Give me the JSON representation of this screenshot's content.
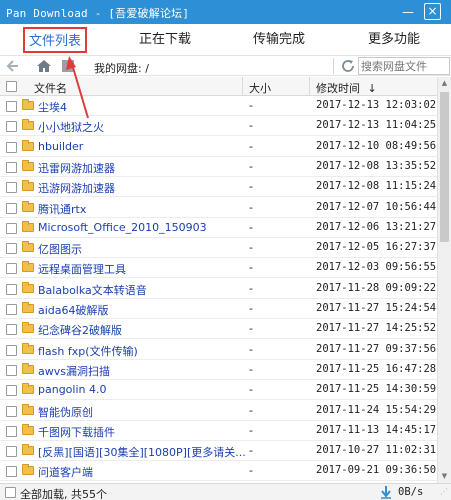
{
  "window": {
    "title": "Pan Download - [吾爱破解论坛]",
    "minimize_glyph": "—",
    "close_glyph": "×"
  },
  "tabs": [
    {
      "label": "文件列表",
      "active": true
    },
    {
      "label": "正在下载",
      "active": false
    },
    {
      "label": "传输完成",
      "active": false
    },
    {
      "label": "更多功能",
      "active": false
    }
  ],
  "toolbar": {
    "path": "我的网盘: /",
    "search_placeholder": "搜索网盘文件",
    "icons": [
      "back-arrow-icon",
      "home-icon",
      "stop-icon",
      "refresh-icon"
    ]
  },
  "table": {
    "columns": {
      "name": "文件名",
      "size": "大小",
      "time": "修改时间"
    },
    "sort_indicator": "↓",
    "rows": [
      {
        "name": "尘埃4",
        "size": "-",
        "time": "2017-12-13 12:03:02"
      },
      {
        "name": "小小地狱之火",
        "size": "-",
        "time": "2017-12-13 11:04:25"
      },
      {
        "name": "hbuilder",
        "size": "-",
        "time": "2017-12-10 08:49:56"
      },
      {
        "name": "迅雷网游加速器",
        "size": "-",
        "time": "2017-12-08 13:35:52"
      },
      {
        "name": "迅游网游加速器",
        "size": "-",
        "time": "2017-12-08 11:15:24"
      },
      {
        "name": "腾讯通rtx",
        "size": "-",
        "time": "2017-12-07 10:56:44"
      },
      {
        "name": "Microsoft_Office_2010_150903",
        "size": "-",
        "time": "2017-12-06 13:21:27"
      },
      {
        "name": "亿图图示",
        "size": "-",
        "time": "2017-12-05 16:27:37"
      },
      {
        "name": "远程桌面管理工具",
        "size": "-",
        "time": "2017-12-03 09:56:55"
      },
      {
        "name": "Balabolka文本转语音",
        "size": "-",
        "time": "2017-11-28 09:09:22"
      },
      {
        "name": "aida64破解版",
        "size": "-",
        "time": "2017-11-27 15:24:54"
      },
      {
        "name": "纪念碑谷2破解版",
        "size": "-",
        "time": "2017-11-27 14:25:52"
      },
      {
        "name": "flash fxp(文件传输)",
        "size": "-",
        "time": "2017-11-27 09:37:56"
      },
      {
        "name": "awvs漏洞扫描",
        "size": "-",
        "time": "2017-11-25 16:47:28"
      },
      {
        "name": "pangolin 4.0",
        "size": "-",
        "time": "2017-11-25 14:30:59"
      },
      {
        "name": "智能伪原创",
        "size": "-",
        "time": "2017-11-24 15:54:29"
      },
      {
        "name": "千图网下载插件",
        "size": "-",
        "time": "2017-11-13 14:45:17"
      },
      {
        "name": "[反黑][国语][30集全][1080P][更多请关...",
        "size": "-",
        "time": "2017-10-27 11:02:31"
      },
      {
        "name": "问道客户端",
        "size": "-",
        "time": "2017-09-21 09:36:50"
      }
    ]
  },
  "status": {
    "text": "全部加载, 共55个",
    "speed": "0B/s"
  },
  "colors": {
    "titlebar": "#2d8fd5",
    "active_tab_text": "#2b6fc6",
    "annotation_red": "#e03b3b",
    "link_blue": "#1a3fb0",
    "folder_yellow": "#f1c04b"
  }
}
